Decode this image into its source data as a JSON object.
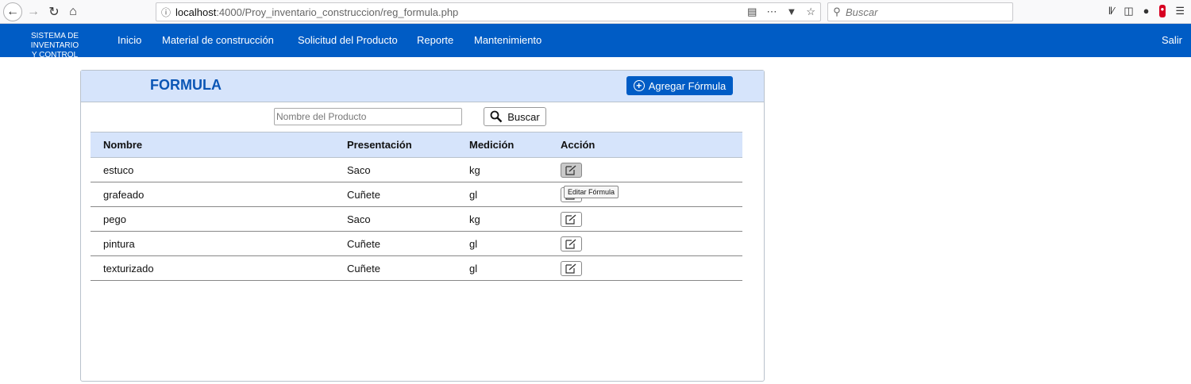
{
  "browser": {
    "url_host": "localhost",
    "url_path": ":4000/Proy_inventario_construccion/reg_formula.php",
    "search_placeholder": "Buscar"
  },
  "navbar": {
    "brand_line1": "SISTEMA DE INVENTARIO",
    "brand_line2": "Y CONTROL",
    "items": [
      {
        "label": "Inicio"
      },
      {
        "label": "Material de construcción"
      },
      {
        "label": "Solicitud del Producto"
      },
      {
        "label": "Reporte"
      },
      {
        "label": "Mantenimiento"
      }
    ],
    "logout_label": "Salir",
    "color": "#005cc5"
  },
  "panel": {
    "title": "FORMULA",
    "add_button_label": "Agregar Fórmula",
    "search_placeholder": "Nombre del Producto",
    "search_button_label": "Buscar",
    "header_color": "#d6e4fb"
  },
  "table": {
    "headers": [
      "Nombre",
      "Presentación",
      "Medición",
      "Acción"
    ],
    "rows": [
      {
        "nombre": "estuco",
        "presentacion": "Saco",
        "medicion": "kg"
      },
      {
        "nombre": "grafeado",
        "presentacion": "Cuñete",
        "medicion": "gl"
      },
      {
        "nombre": "pego",
        "presentacion": "Saco",
        "medicion": "kg"
      },
      {
        "nombre": "pintura",
        "presentacion": "Cuñete",
        "medicion": "gl"
      },
      {
        "nombre": "texturizado",
        "presentacion": "Cuñete",
        "medicion": "gl"
      }
    ],
    "tooltip": "Editar Fórmula"
  }
}
